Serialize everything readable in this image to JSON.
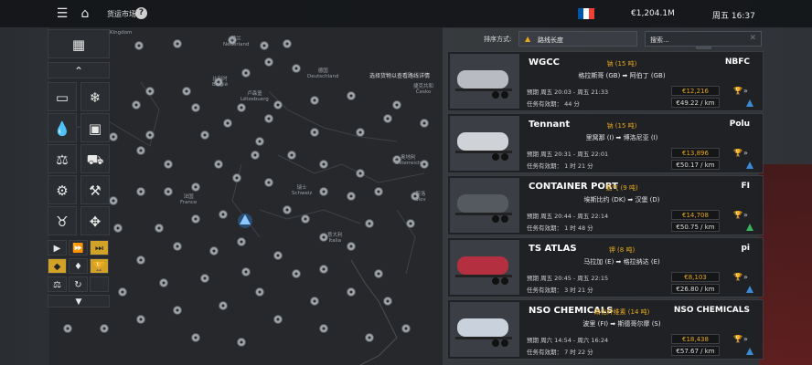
{
  "topbar": {
    "breadcrumb": "货运市场",
    "money": "€1,204.1M",
    "clock": "周五 16:37",
    "flag_colors": [
      "#0055a4",
      "#ffffff",
      "#ef4135"
    ]
  },
  "tools": [
    {
      "icon": "pallets-icon"
    },
    {
      "icon": "chevron-up-icon"
    },
    {
      "icon": "container-icon"
    },
    {
      "icon": "snowflake-icon"
    },
    {
      "icon": "liquid-icon"
    },
    {
      "icon": "tv-icon"
    },
    {
      "icon": "scale-icon"
    },
    {
      "icon": "truck-crane-icon"
    },
    {
      "icon": "gear-icon"
    },
    {
      "icon": "machinery-icon"
    },
    {
      "icon": "livestock-icon"
    },
    {
      "icon": "expand-icon"
    }
  ],
  "map": {
    "hint": "选择货物以查看路线详情",
    "labels": [
      {
        "t": "Kingdom"
      },
      {
        "t": "荷兰\nNederland"
      },
      {
        "t": "德国\nDeutschland"
      },
      {
        "t": "比利时\nBelgië"
      },
      {
        "t": "卢森堡\nLëtzebuerg"
      },
      {
        "t": "捷克共和\nČesko"
      },
      {
        "t": "法国\nFrance"
      },
      {
        "t": "瑞士\nSchweiz"
      },
      {
        "t": "奥地利\nÖsterreich"
      },
      {
        "t": "斯洛\nSlov"
      },
      {
        "t": "意大利\nItalia"
      }
    ]
  },
  "sort": {
    "label": "排序方式:",
    "value": "路线长度",
    "search_placeholder": "搜索..."
  },
  "jobs": [
    {
      "company_left": "WGCC",
      "company_right": "NBFC",
      "cargo": "钠 (15 吨)",
      "route": "格拉斯哥 (GB) ➡ 阿伯丁 (GB)",
      "time": "预期 周五 20:03 - 周五 21:33",
      "valid": "任务有效期： 44 分",
      "price": "€12,216",
      "perkm": "€49.22 / km"
    },
    {
      "company_left": "Tennant",
      "company_right": "Polu",
      "cargo": "钠 (15 吨)",
      "route": "里窝那 (I) ➡ 博洛尼亚 (I)",
      "time": "预期 周五 20:31 - 周五 22:01",
      "valid": "任务有效期： 1 时 21 分",
      "price": "€13,896",
      "perkm": "€50.17 / km"
    },
    {
      "company_left": "CONTAINER PORT",
      "company_right": "FI",
      "cargo": "氪气 (9 吨)",
      "route": "埃斯比约 (DK) ➡ 汉堡 (D)",
      "time": "预期 周五 20:44 - 周五 22:14",
      "valid": "任务有效期： 1 时 48 分",
      "price": "€14,708",
      "perkm": "€50.75 / km"
    },
    {
      "company_left": "TS ATLAS",
      "company_right": "pi",
      "cargo": "钾 (8 吨)",
      "route": "马拉加 (E) ➡ 格拉纳达 (E)",
      "time": "预期 周五 20:45 - 周五 22:15",
      "valid": "任务有效期： 3 时 21 分",
      "price": "€8,103",
      "perkm": "€26.80 / km"
    },
    {
      "company_left": "NSO CHEMICALS",
      "company_right": "NSO CHEMICALS",
      "cargo": "硝化纤维素 (14 吨)",
      "route": "波里 (FI) ➡ 斯德哥尔摩 (S)",
      "time": "预期 周六 14:54 - 周六 16:24",
      "valid": "任务有效期： 7 时 22 分",
      "price": "€18,438",
      "perkm": "€57.67 / km"
    }
  ]
}
